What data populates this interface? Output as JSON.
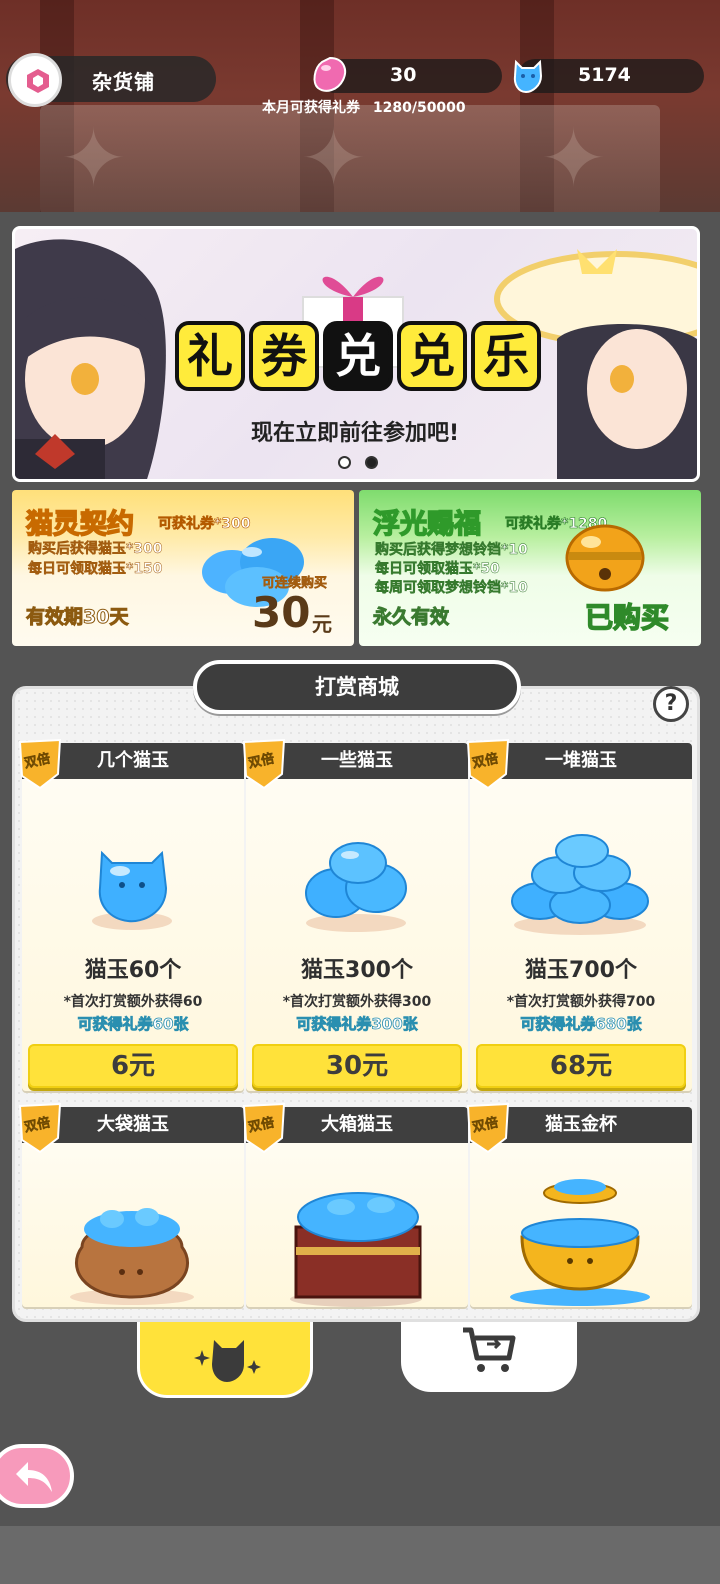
{
  "header": {
    "store_title": "杂货铺",
    "pink_currency": {
      "icon": "pink-gem-icon",
      "value": "30"
    },
    "blue_currency": {
      "icon": "blue-cat-gem-icon",
      "value": "5174"
    },
    "quota_label": "本月可获得礼券",
    "quota_value": "1280/50000"
  },
  "banner": {
    "title_chars": [
      "礼",
      "券",
      "兑",
      "兑",
      "乐"
    ],
    "subtitle": "现在立即前往参加吧!",
    "pages": 2,
    "active_page": 2
  },
  "promos": [
    {
      "title": "猫灵契约",
      "tag": "可获礼券*300",
      "lines": [
        "购买后获得猫玉*300",
        "每日可领取猫玉*150"
      ],
      "validity": "有效期30天",
      "note": "可连续购买",
      "price_num": "30",
      "price_unit": "元"
    },
    {
      "title": "浮光赐福",
      "tag": "可获礼券*1280",
      "lines": [
        "购买后获得梦想铃铛*10",
        "每日可领取猫玉*50",
        "每周可领取梦想铃铛*10"
      ],
      "validity": "永久有效",
      "status": "已购买"
    }
  ],
  "shop": {
    "tab_title": "打赏商城",
    "help_label": "?",
    "badge_label": "双倍",
    "items": [
      {
        "name": "几个猫玉",
        "amount": "猫玉60个",
        "bonus": "*首次打赏额外获得60",
        "ticket": "可获得礼券60张",
        "price": "6元"
      },
      {
        "name": "一些猫玉",
        "amount": "猫玉300个",
        "bonus": "*首次打赏额外获得300",
        "ticket": "可获得礼券300张",
        "price": "30元"
      },
      {
        "name": "一堆猫玉",
        "amount": "猫玉700个",
        "bonus": "*首次打赏额外获得700",
        "ticket": "可获得礼券680张",
        "price": "68元"
      },
      {
        "name": "大袋猫玉"
      },
      {
        "name": "大箱猫玉"
      },
      {
        "name": "猫玉金杯"
      }
    ]
  },
  "nav": {
    "left_icon": "cat-sparkle-icon",
    "right_icon": "cart-icon",
    "back_icon": "back-arrow-icon"
  },
  "colors": {
    "accent_yellow": "#ffe23a",
    "dark": "#3f3f3f",
    "gem_blue": "#4fb8ff",
    "pink": "#f79abb"
  }
}
